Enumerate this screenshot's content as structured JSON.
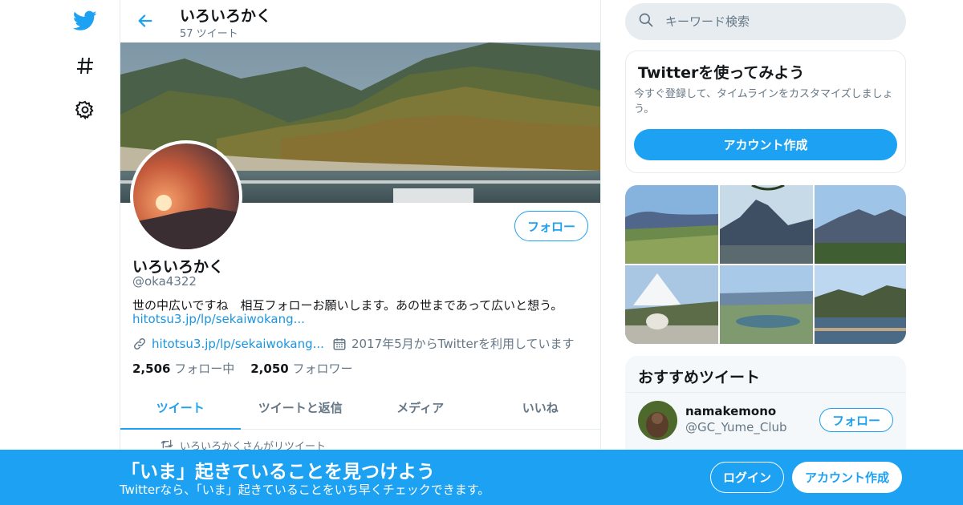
{
  "colors": {
    "accent": "#1da1f2",
    "link": "#1b95e0",
    "muted": "#657786",
    "border": "#e6ecf0"
  },
  "nav": {
    "icons": [
      "twitter-bird-icon",
      "hashtag-icon",
      "gear-icon"
    ]
  },
  "header": {
    "name": "いろいろかく",
    "tweet_count": "57 ツイート"
  },
  "profile": {
    "name": "いろいろかく",
    "handle": "@oka4322",
    "bio": "世の中広いですね　相互フォローお願いします。あの世まであって広いと想う。",
    "bio_link": "hitotsu3.jp/lp/sekaiwokang...",
    "website": "hitotsu3.jp/lp/sekaiwokang...",
    "joined": "2017年5月からTwitterを利用しています",
    "follow_label": "フォロー",
    "following_count": "2,506",
    "following_label": "フォロー中",
    "followers_count": "2,050",
    "followers_label": "フォロワー"
  },
  "tabs": [
    {
      "label": "ツイート",
      "active": true
    },
    {
      "label": "ツイートと返信",
      "active": false
    },
    {
      "label": "メディア",
      "active": false
    },
    {
      "label": "いいね",
      "active": false
    }
  ],
  "retweet_note": "いろいろかくさんがリツイート",
  "search": {
    "placeholder": "キーワード検索"
  },
  "signup_card": {
    "title": "Twitterを使ってみよう",
    "desc": "今すぐ登録して、タイムラインをカスタマイズしましょう。",
    "button": "アカウント作成"
  },
  "recommended": {
    "title": "おすすめツイート",
    "user": {
      "name": "namakemono",
      "handle": "@GC_Yume_Club",
      "follow_label": "フォロー"
    }
  },
  "bottom_bar": {
    "headline": "「いま」起きていることを見つけよう",
    "sub": "Twitterなら、「いま」起きていることをいち早くチェックできます。",
    "login": "ログイン",
    "signup": "アカウント作成"
  }
}
